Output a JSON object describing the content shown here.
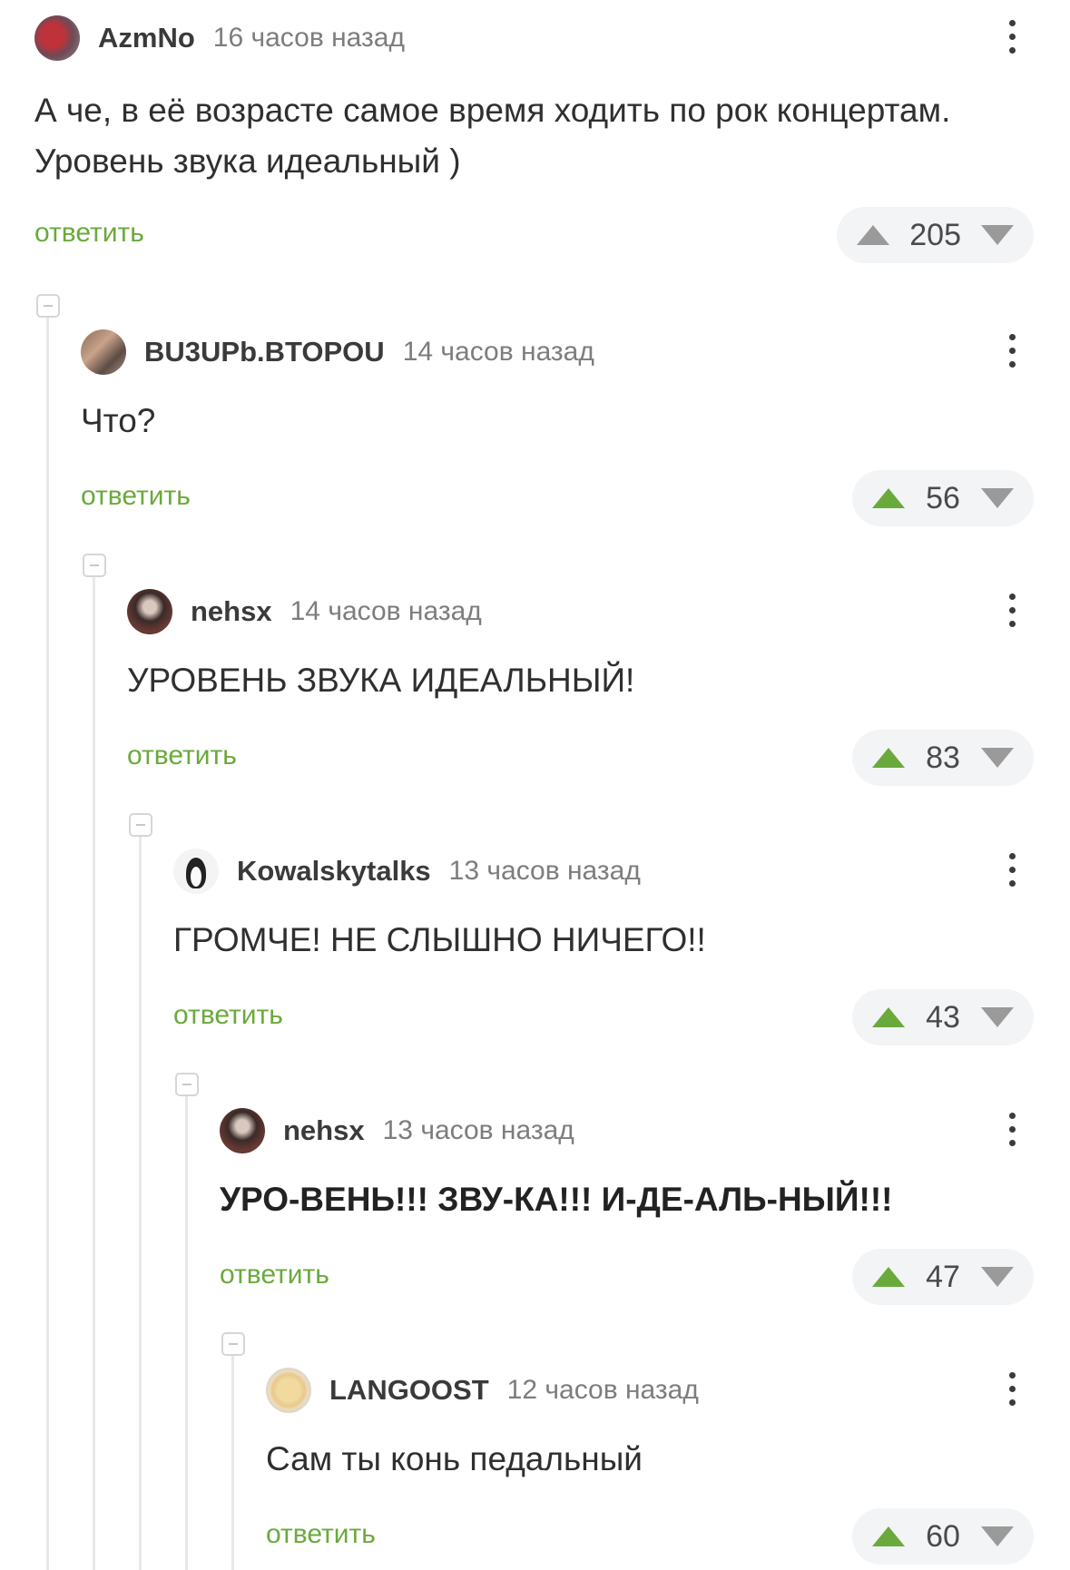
{
  "comments": [
    {
      "username": "AzmNo",
      "time": "16 часов назад",
      "text": "А че, в её возрасте самое время ходить по рок концертам. Уровень звука идеальный )",
      "reply": "ответить",
      "score": "205"
    },
    {
      "username": "BU3UPb.BTOPOU",
      "time": "14 часов назад",
      "text": "Что?",
      "reply": "ответить",
      "score": "56"
    },
    {
      "username": "nehsx",
      "time": "14 часов назад",
      "text": "УРОВЕНЬ ЗВУКА ИДЕАЛЬНЫЙ!",
      "reply": "ответить",
      "score": "83"
    },
    {
      "username": "Kowalskytalks",
      "time": "13 часов назад",
      "text": "ГРОМЧЕ! НЕ СЛЫШНО НИЧЕГО!!",
      "reply": "ответить",
      "score": "43"
    },
    {
      "username": "nehsx",
      "time": "13 часов назад",
      "text": "УРО-ВЕНЬ!!! ЗВУ-КА!!! И-ДЕ-АЛЬ-НЫЙ!!!",
      "reply": "ответить",
      "score": "47"
    },
    {
      "username": "LANGOOST",
      "time": "12 часов назад",
      "text": "Сам ты конь педальный",
      "reply": "ответить",
      "score": "60"
    }
  ],
  "colors": {
    "accent_green": "#6aaa3c",
    "arrow_gray": "#9a9a9a",
    "rating_bg": "#f3f4f6"
  },
  "icons": [
    "upvote-arrow-icon",
    "downvote-arrow-icon",
    "more-options-icon",
    "collapse-thread-icon"
  ]
}
